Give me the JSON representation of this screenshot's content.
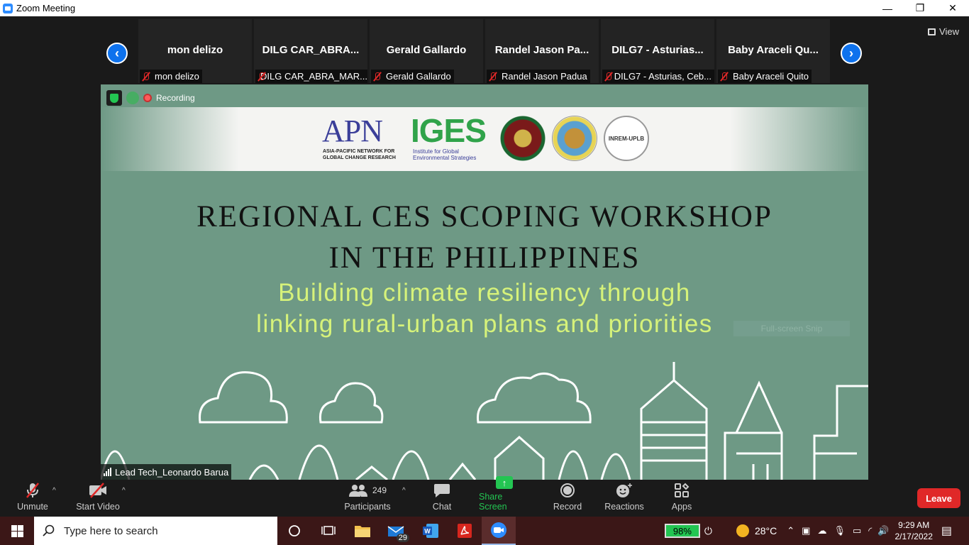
{
  "window": {
    "title": "Zoom Meeting",
    "minimize": "—",
    "maximize": "❐",
    "close": "✕"
  },
  "view": {
    "label": "View"
  },
  "gallery": {
    "prev": "‹",
    "next": "›",
    "tiles": [
      {
        "name": "mon delizo",
        "label": "mon delizo"
      },
      {
        "name": "DILG CAR_ABRA...",
        "label": "DILG CAR_ABRA_MAR..."
      },
      {
        "name": "Gerald Gallardo",
        "label": "Gerald Gallardo"
      },
      {
        "name": "Randel Jason Pa...",
        "label": "Randel Jason Padua"
      },
      {
        "name": "DILG7 - Asturias...",
        "label": "DILG7 - Asturias, Ceb..."
      },
      {
        "name": "Baby Araceli Qu...",
        "label": "Baby Araceli Quito"
      }
    ]
  },
  "share": {
    "recording": "Recording",
    "logos": {
      "apn": "APN",
      "apn_sub1": "ASIA-PACIFIC NETWORK FOR",
      "apn_sub2": "GLOBAL CHANGE RESEARCH",
      "iges": "IGES",
      "iges_sub1": "Institute for Global",
      "iges_sub2": "Environmental Strategies",
      "seal3": "INREM-UPLB"
    },
    "title_line1": "REGIONAL CES SCOPING WORKSHOP",
    "title_line2": "IN THE PHILIPPINES",
    "subtitle_line1": "Building climate resiliency through",
    "subtitle_line2": "linking rural-urban plans and priorities",
    "snip": "Full-screen Snip",
    "speaker": "Lead Tech_Leonardo Barua"
  },
  "toolbar": {
    "unmute": "Unmute",
    "start_video": "Start Video",
    "participants": "Participants",
    "participants_count": "249",
    "chat": "Chat",
    "share_screen": "Share Screen",
    "record": "Record",
    "reactions": "Reactions",
    "apps": "Apps",
    "leave": "Leave",
    "caret": "^"
  },
  "taskbar": {
    "search_placeholder": "Type here to search",
    "mail_badge": "29",
    "battery": "98%",
    "temperature": "28°C",
    "time": "9:29 AM",
    "date": "2/17/2022"
  },
  "colors": {
    "zoom_blue": "#0e72ed",
    "share_green": "#23c552",
    "leave_red": "#e02828",
    "slide_bg": "#6e9985",
    "subtitle_lime": "#d6f27a"
  }
}
